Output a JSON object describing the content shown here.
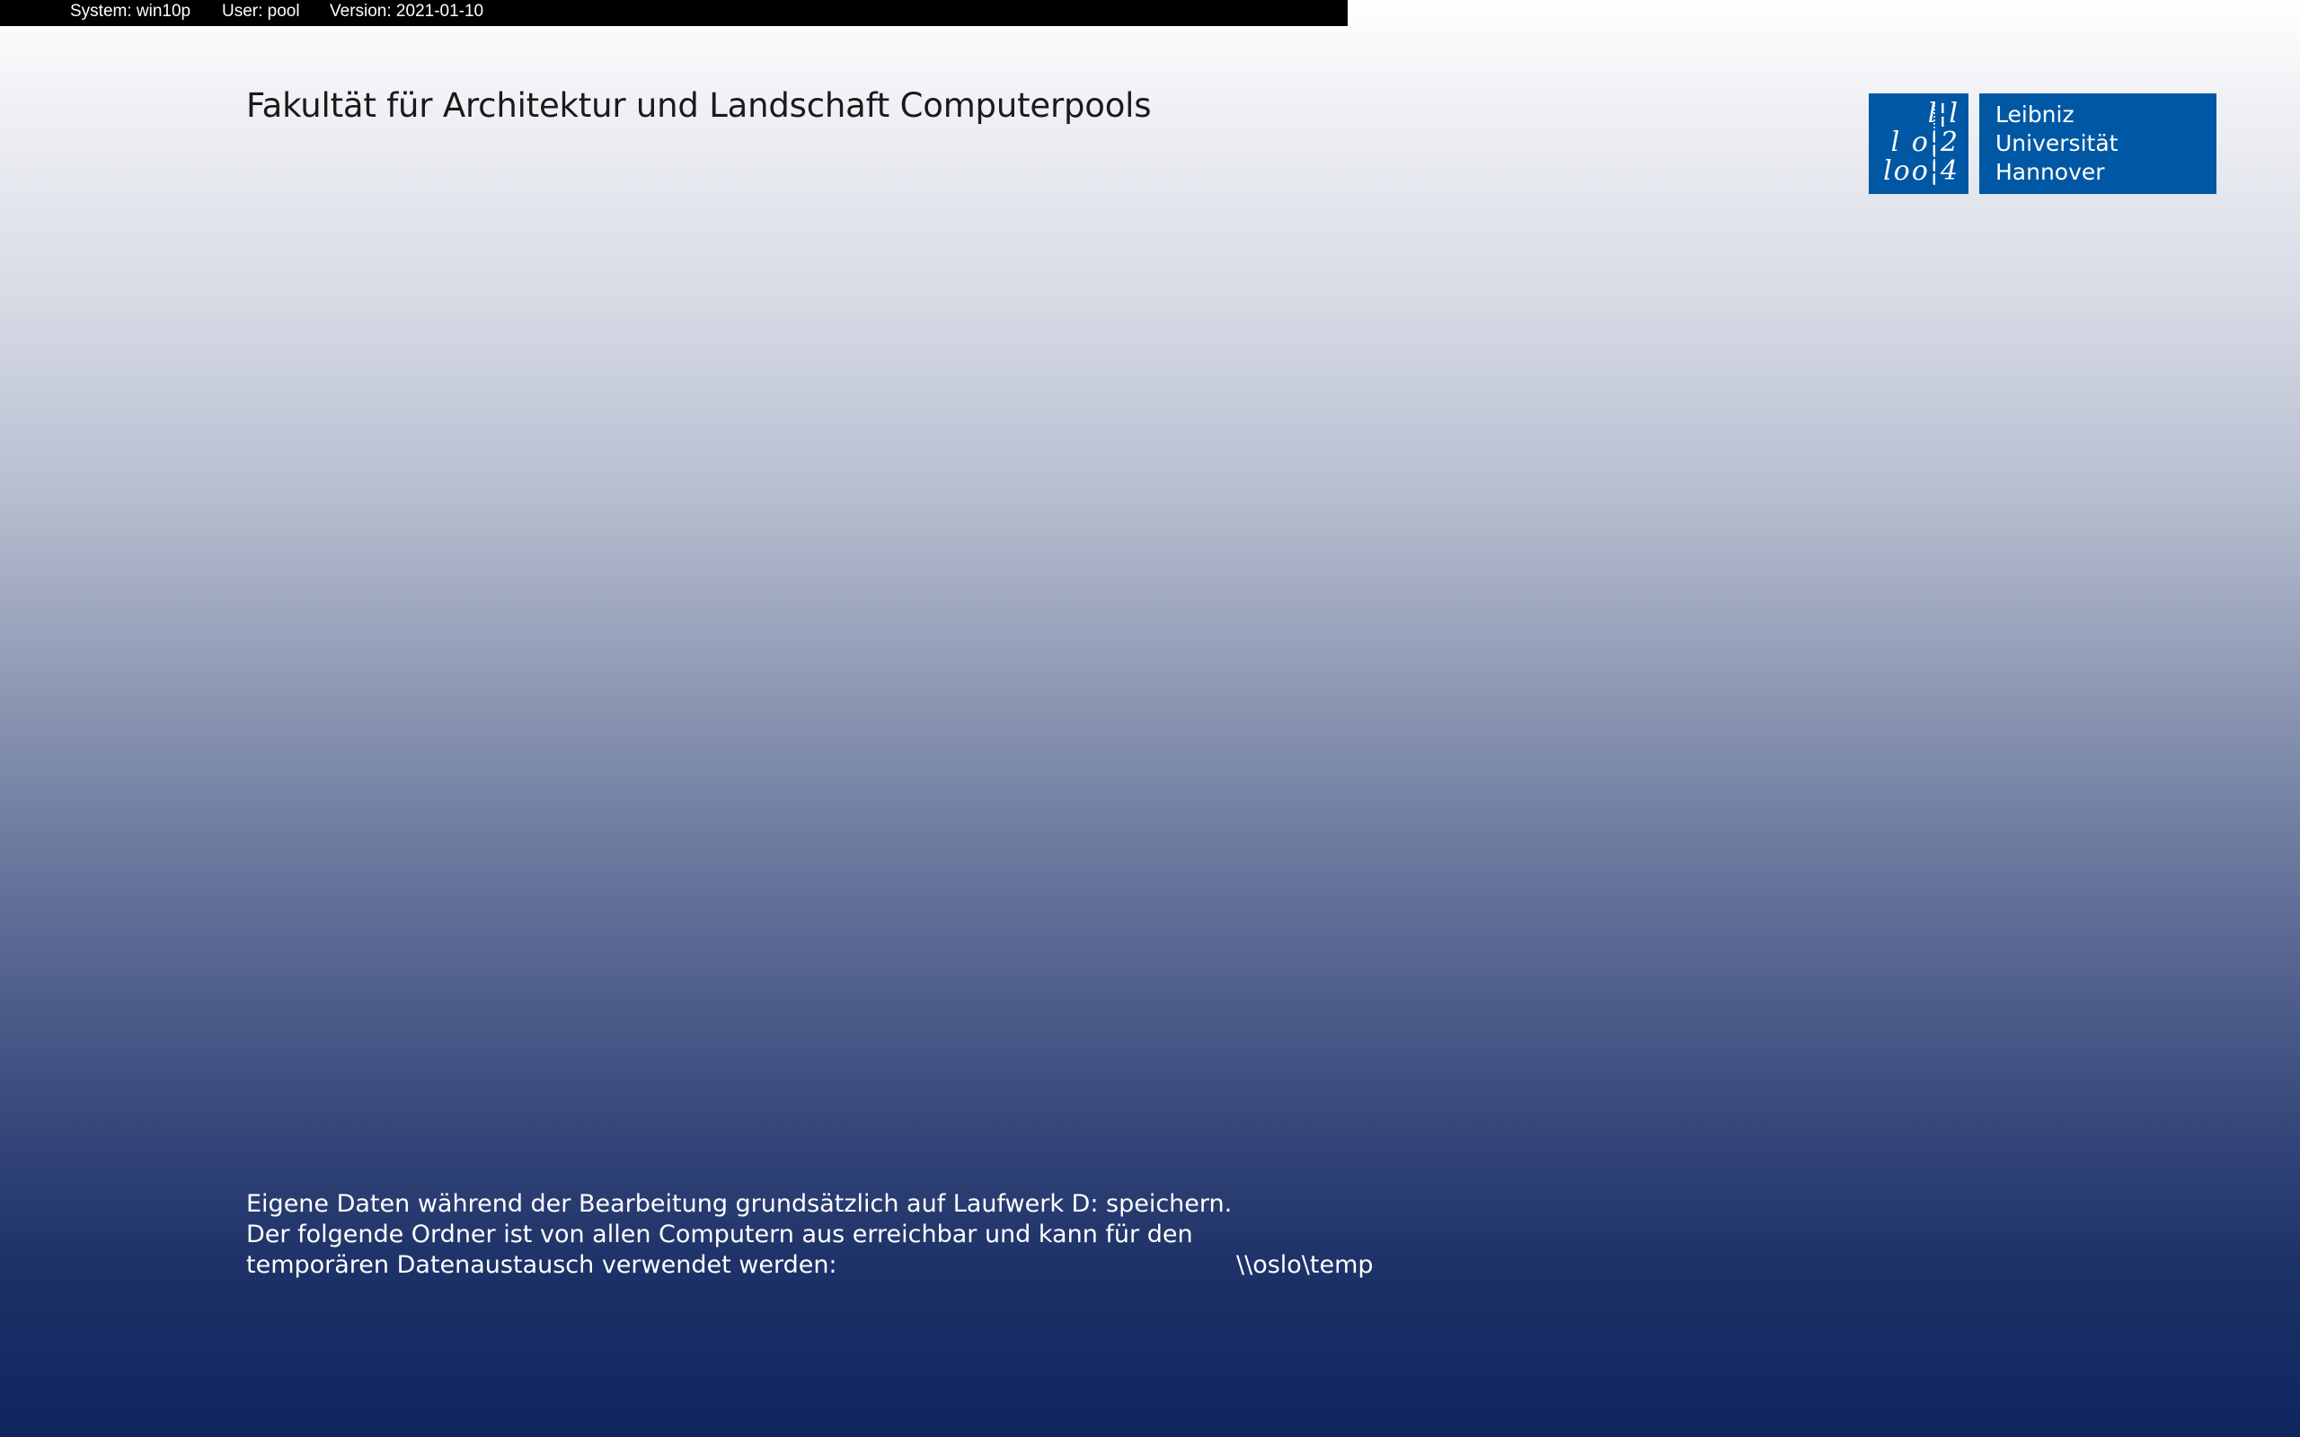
{
  "info_bar": {
    "system": "System: win10p",
    "user": "User: pool",
    "version": "Version: 2021-01-10"
  },
  "title": "Fakultät für Architektur und Landschaft Computerpools",
  "logo": {
    "mark_rows": [
      "l¦l",
      "l o¦2",
      "loo¦4"
    ],
    "text_lines": [
      "Leibniz",
      "Universität",
      "Hannover"
    ],
    "color": "#0058a4"
  },
  "notice": {
    "line1": "Eigene Daten während der Bearbeitung grundsätzlich auf Laufwerk D: speichern.",
    "line2": "Der folgende Ordner ist von allen Computern aus erreichbar und kann für den",
    "line3": "temporären Datenaustausch verwendet werden:",
    "path": "\\\\oslo\\temp"
  },
  "colors": {
    "gradient_top": "#ffffff",
    "gradient_bottom": "#0f255e",
    "info_bar_bg": "#000000"
  }
}
